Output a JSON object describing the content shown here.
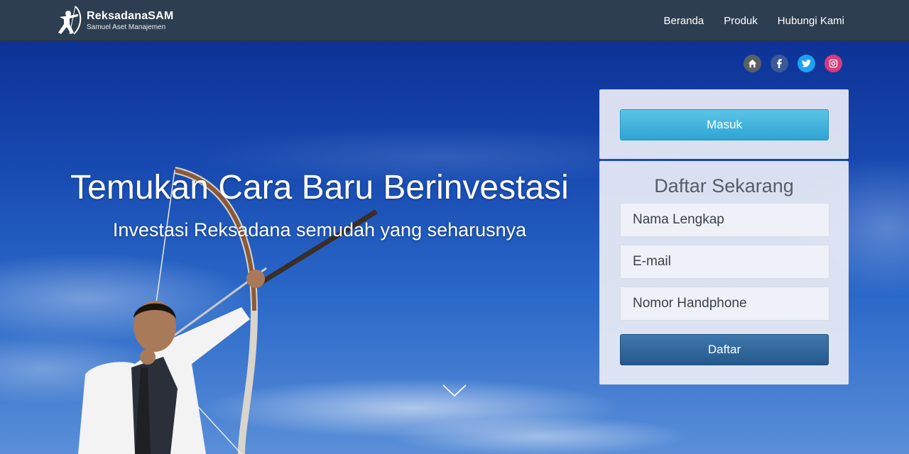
{
  "brand": {
    "name": "ReksadanaSAM",
    "tagline": "Samuel Aset Manajemen"
  },
  "nav": {
    "items": [
      {
        "label": "Beranda"
      },
      {
        "label": "Produk"
      },
      {
        "label": "Hubungi Kami"
      }
    ]
  },
  "social": {
    "icons": [
      {
        "name": "home-icon",
        "color": "#5a5f66"
      },
      {
        "name": "facebook-icon",
        "color": "#3b5998"
      },
      {
        "name": "twitter-icon",
        "color": "#1da1f2"
      },
      {
        "name": "instagram-icon",
        "color": "#d83c7e"
      }
    ]
  },
  "hero": {
    "headline": "Temukan Cara Baru Berinvestasi",
    "subheadline": "Investasi Reksadana semudah yang seharusnya"
  },
  "login": {
    "button_label": "Masuk"
  },
  "register": {
    "title": "Daftar Sekarang",
    "name_placeholder": "Nama Lengkap",
    "email_placeholder": "E-mail",
    "phone_placeholder": "Nomor Handphone",
    "submit_label": "Daftar"
  },
  "colors": {
    "navbar": "#2d3e50",
    "masuk_button": "#38aedb",
    "daftar_button": "#2f6699"
  }
}
